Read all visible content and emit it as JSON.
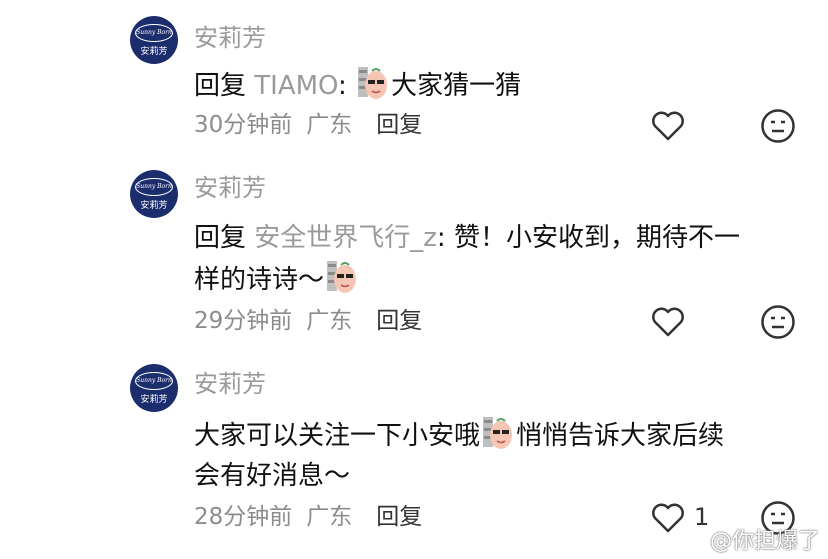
{
  "comments": [
    {
      "author": "安莉芳",
      "reply_prefix": "回复 ",
      "mention": "TIAMO",
      "colon": ": ",
      "text_a": "大家猜一猜",
      "text_b": "",
      "line2": "",
      "time": "30分钟前",
      "location": "广东",
      "reply_label": "回复",
      "likes": ""
    },
    {
      "author": "安莉芳",
      "reply_prefix": "回复 ",
      "mention": "安全世界飞行_z",
      "colon": ": ",
      "text_a": "赞！小安收到，期待不一",
      "text_b": "",
      "line2": "样的诗诗～",
      "time": "29分钟前",
      "location": "广东",
      "reply_label": "回复",
      "likes": ""
    },
    {
      "author": "安莉芳",
      "reply_prefix": "",
      "mention": "",
      "colon": "",
      "text_a": "大家可以关注一下小安哦",
      "text_b": "悄悄告诉大家后续",
      "line2": "会有好消息～",
      "time": "28分钟前",
      "location": "广东",
      "reply_label": "回复",
      "likes": "1"
    }
  ],
  "avatar": {
    "brand_text": "Sunny Born",
    "cn_text": "安莉芳",
    "color": "#1c2d6e"
  },
  "watermark": "@你担爆了",
  "icons": [
    "heart-icon",
    "neutral-face-icon",
    "emoji-sticker-icon",
    "weibo-logo-icon"
  ]
}
